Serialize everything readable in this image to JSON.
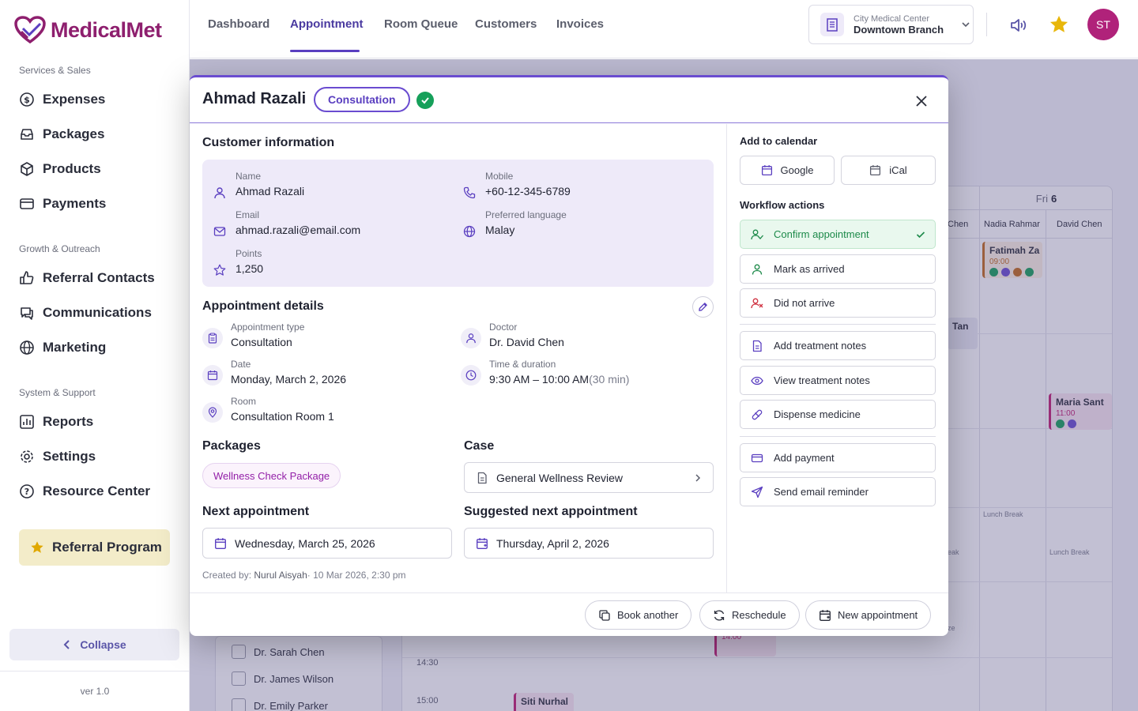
{
  "brand": {
    "name": "MedicalMet"
  },
  "sidebar": {
    "sections": [
      {
        "label": "Services & Sales",
        "items": [
          {
            "label": "Expenses",
            "icon": "dollar-icon"
          },
          {
            "label": "Packages",
            "icon": "inbox-icon"
          },
          {
            "label": "Products",
            "icon": "box-icon"
          },
          {
            "label": "Payments",
            "icon": "card-icon"
          }
        ]
      },
      {
        "label": "Growth & Outreach",
        "items": [
          {
            "label": "Referral Contacts",
            "icon": "thumbs-up-icon"
          },
          {
            "label": "Communications",
            "icon": "chat-icon"
          },
          {
            "label": "Marketing",
            "icon": "globe-icon"
          }
        ]
      },
      {
        "label": "System & Support",
        "items": [
          {
            "label": "Reports",
            "icon": "chart-icon"
          },
          {
            "label": "Settings",
            "icon": "gear-icon"
          },
          {
            "label": "Resource Center",
            "icon": "help-icon"
          }
        ]
      }
    ],
    "referral_label": "Referral Program",
    "collapse_label": "Collapse",
    "version": "ver 1.0"
  },
  "topnav": {
    "tabs": [
      "Dashboard",
      "Appointment",
      "Room Queue",
      "Customers",
      "Invoices"
    ],
    "active_tab": "Appointment",
    "branch_small": "City Medical Center",
    "branch_big": "Downtown Branch",
    "avatar_initials": "ST"
  },
  "calendar": {
    "day_label": "Fri",
    "day_number": "6",
    "columns": [
      "Chen",
      "Nadia Rahmar",
      "David Chen"
    ],
    "times": [
      "14:30",
      "15:00"
    ],
    "events": [
      {
        "name": "Fatimah Za",
        "time": "09:00"
      },
      {
        "name": "Tan",
        "time": ""
      },
      {
        "name": "Maria Sant",
        "time": "11:00"
      },
      {
        "name": "Siti Nurhal",
        "time": ""
      },
      {
        "name": "",
        "time": "14:00"
      }
    ],
    "lunch_label": "Lunch Break",
    "lunch_fragment_1": "eak",
    "lunch_fragment_2": "ze",
    "doctors": [
      "Dr. Sarah Chen",
      "Dr. James Wilson",
      "Dr. Emily Parker"
    ]
  },
  "modal": {
    "patient_name": "Ahmad Razali",
    "type_chip": "Consultation",
    "customer": {
      "title": "Customer information",
      "name_label": "Name",
      "name": "Ahmad Razali",
      "mobile_label": "Mobile",
      "mobile": "+60-12-345-6789",
      "email_label": "Email",
      "email": "ahmad.razali@email.com",
      "lang_label": "Preferred language",
      "lang": "Malay",
      "points_label": "Points",
      "points": "1,250"
    },
    "details": {
      "title": "Appointment details",
      "type_label": "Appointment type",
      "type": "Consultation",
      "doctor_label": "Doctor",
      "doctor": "Dr. David Chen",
      "date_label": "Date",
      "date": "Monday, March 2, 2026",
      "time_label": "Time & duration",
      "time": "9:30 AM – 10:00 AM",
      "duration": "(30 min)",
      "room_label": "Room",
      "room": "Consultation Room 1"
    },
    "packages_title": "Packages",
    "package": "Wellness Check Package",
    "case_title": "Case",
    "case": "General Wellness Review",
    "next_title": "Next appointment",
    "next_date": "Wednesday, March 25, 2026",
    "suggested_title": "Suggested next appointment",
    "suggested_date": "Thursday, April 2, 2026",
    "created_prefix": "Created by:",
    "created_by": "Nurul Aisyah",
    "created_at": "· 10 Mar 2026, 2:30 pm",
    "calendar_title": "Add to calendar",
    "google": "Google",
    "ical": "iCal",
    "workflow_title": "Workflow actions",
    "workflow": {
      "confirm": "Confirm appointment",
      "arrived": "Mark as arrived",
      "not_arrive": "Did not arrive",
      "add_notes": "Add treatment notes",
      "view_notes": "View treatment notes",
      "dispense": "Dispense medicine",
      "payment": "Add payment",
      "reminder": "Send email reminder"
    },
    "footer": {
      "book": "Book another",
      "reschedule": "Reschedule",
      "new": "New appointment"
    }
  },
  "colors": {
    "brand": "#8e1f6e",
    "accent": "#5a3fc0",
    "success": "#16a05a",
    "danger": "#d03040"
  }
}
